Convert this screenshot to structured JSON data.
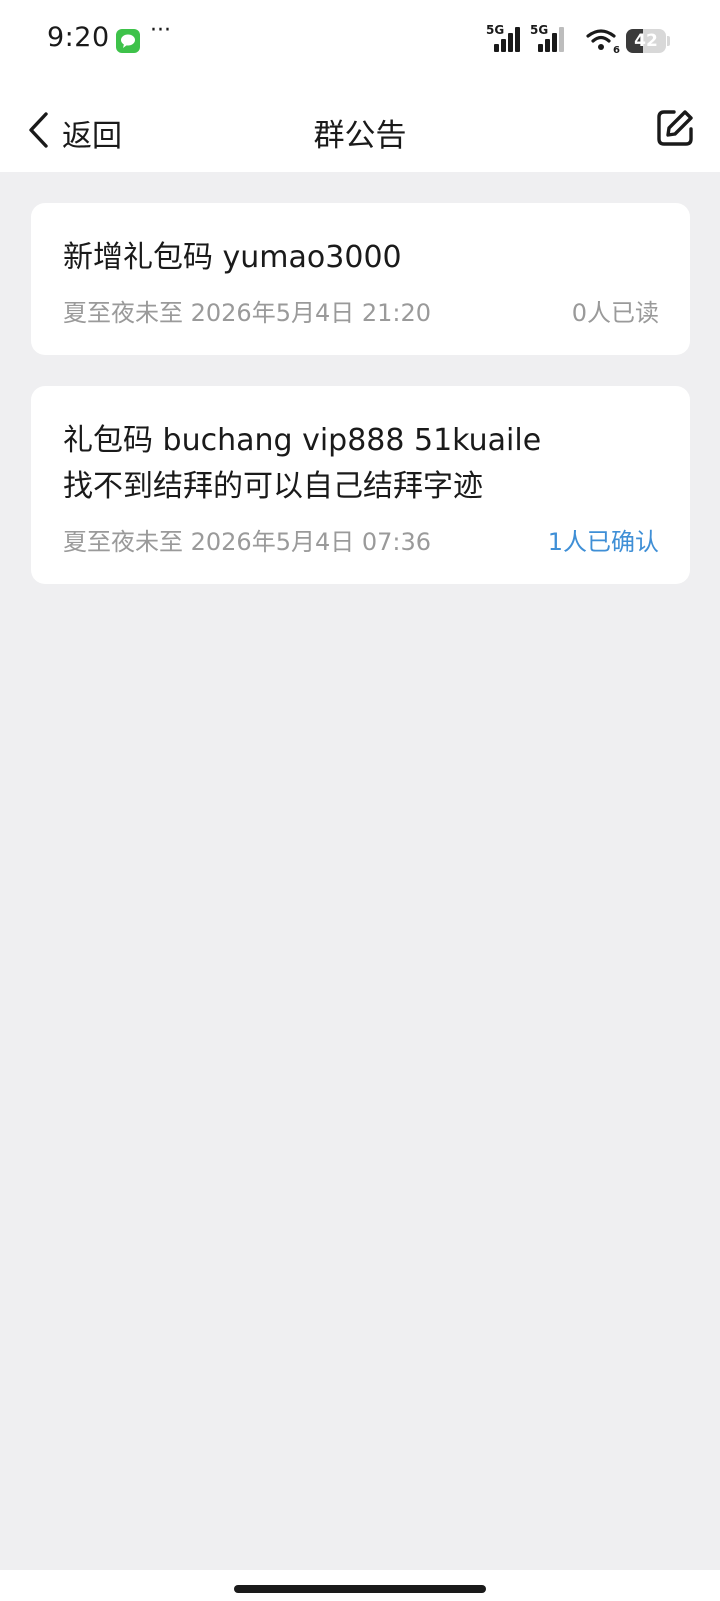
{
  "status_bar": {
    "time": "9:20",
    "more": "···",
    "signal_1_label": "5G",
    "signal_2_label": "5G",
    "wifi_label": "6",
    "battery_level": "42",
    "battery_fraction": 0.42,
    "icons": [
      "message-app-icon",
      "signal-icon",
      "signal-icon",
      "wifi-icon",
      "battery-icon"
    ]
  },
  "nav": {
    "back_label": "返回",
    "title": "群公告",
    "edit_icon": "edit-icon"
  },
  "announcements": [
    {
      "lines": [
        "新增礼包码 yumao3000"
      ],
      "author": "夏至夜未至",
      "date": "2026年5月4日 21:20",
      "meta": "夏至夜未至 2026年5月4日 21:20",
      "read_status": "0人已读",
      "read_status_color": "#9a9a9a"
    },
    {
      "lines": [
        "礼包码 buchang vip888 51kuaile",
        "找不到结拜的可以自己结拜字迹"
      ],
      "author": "夏至夜未至",
      "date": "2026年5月4日 07:36",
      "meta": "夏至夜未至 2026年5月4日 07:36",
      "read_status": "1人已确认",
      "read_status_color": "#3f8fd6"
    }
  ],
  "colors": {
    "background": "#efeff1",
    "card": "#ffffff",
    "text": "#1a1a1a",
    "meta": "#9a9a9a",
    "accent": "#3f8fd6",
    "app_icon_green": "#3ec24a"
  }
}
